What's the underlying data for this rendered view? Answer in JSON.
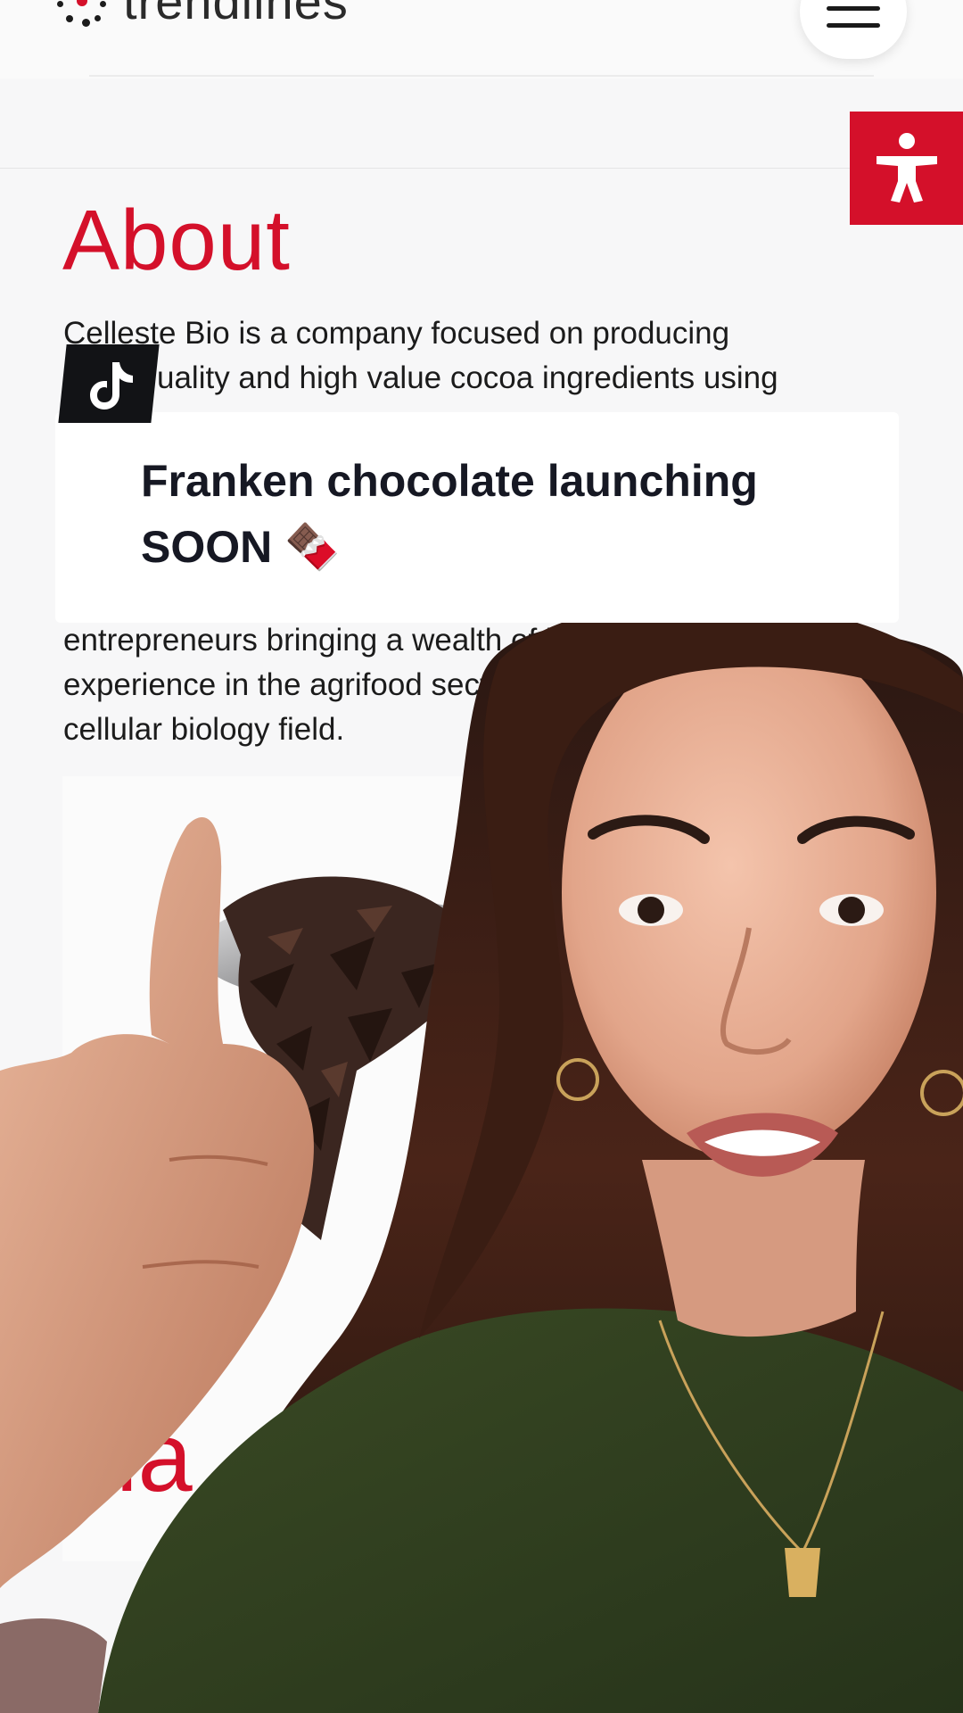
{
  "site": {
    "logo_text": "trendlines",
    "menu_icon": "hamburger-menu-icon",
    "accessibility_icon": "accessibility-person-icon",
    "brand_red": "#d4102a"
  },
  "about": {
    "title": "About",
    "lines": [
      "Celleste Bio is a company focused on producing",
      "uality and high value cocoa ingredients using",
      "entrepreneurs bringing a wealth of in",
      "experience in the agrifood sector",
      "cellular biology field."
    ]
  },
  "tiktok": {
    "icon": "tiktok-logo-icon"
  },
  "caption": {
    "line1": "Franken chocolate launching",
    "line2": "SOON 🍫"
  },
  "partial_heading": "la"
}
